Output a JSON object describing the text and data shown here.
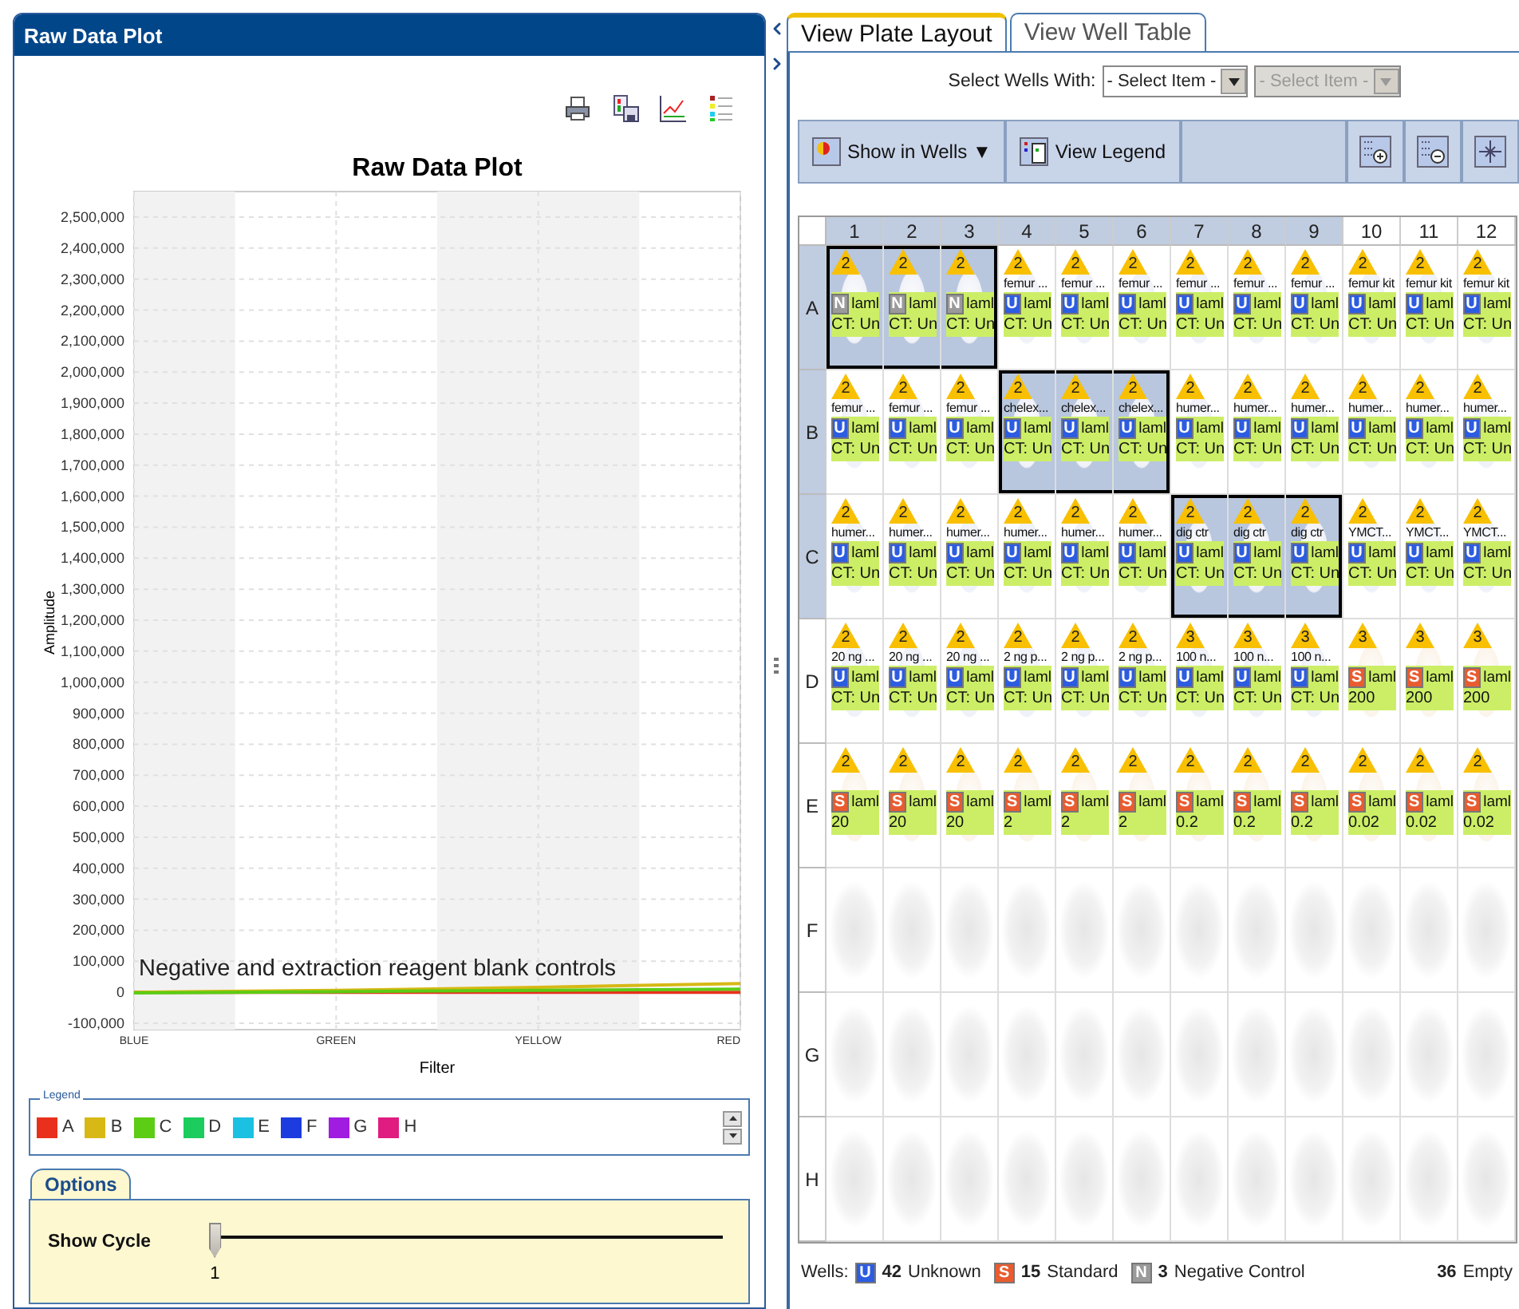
{
  "left_panel": {
    "title": "Raw Data Plot",
    "toolbar": [
      {
        "kind": "print"
      },
      {
        "kind": "save"
      },
      {
        "kind": "edit"
      },
      {
        "kind": "legend"
      }
    ],
    "chart_data": {
      "type": "line",
      "title": "Raw Data Plot",
      "xlabel": "Filter",
      "ylabel": "Amplitude",
      "categories": [
        "BLUE",
        "GREEN",
        "YELLOW",
        "RED"
      ],
      "series": [
        {
          "color": "#e8301c",
          "values": [
            0,
            0,
            0,
            0
          ]
        },
        {
          "color": "#d8b814",
          "values": [
            0,
            6000,
            16000,
            28000
          ]
        },
        {
          "color": "#5ccc14",
          "values": [
            -2000,
            2000,
            6000,
            10000
          ]
        }
      ],
      "grid": true,
      "ylim": [
        -100000,
        2500000
      ],
      "yticks": [
        {
          "value": 2500000,
          "label": "2,500,000"
        },
        {
          "value": 2400000,
          "label": "2,400,000"
        },
        {
          "value": 2300000,
          "label": "2,300,000"
        },
        {
          "value": 2200000,
          "label": "2,200,000"
        },
        {
          "value": 2100000,
          "label": "2,100,000"
        },
        {
          "value": 2000000,
          "label": "2,000,000"
        },
        {
          "value": 1900000,
          "label": "1,900,000"
        },
        {
          "value": 1800000,
          "label": "1,800,000"
        },
        {
          "value": 1700000,
          "label": "1,700,000"
        },
        {
          "value": 1600000,
          "label": "1,600,000"
        },
        {
          "value": 1500000,
          "label": "1,500,000"
        },
        {
          "value": 1400000,
          "label": "1,400,000"
        },
        {
          "value": 1300000,
          "label": "1,300,000"
        },
        {
          "value": 1200000,
          "label": "1,200,000"
        },
        {
          "value": 1100000,
          "label": "1,100,000"
        },
        {
          "value": 1000000,
          "label": "1,000,000"
        },
        {
          "value": 900000,
          "label": "900,000"
        },
        {
          "value": 800000,
          "label": "800,000"
        },
        {
          "value": 700000,
          "label": "700,000"
        },
        {
          "value": 600000,
          "label": "600,000"
        },
        {
          "value": 500000,
          "label": "500,000"
        },
        {
          "value": 400000,
          "label": "400,000"
        },
        {
          "value": 300000,
          "label": "300,000"
        },
        {
          "value": 200000,
          "label": "200,000"
        },
        {
          "value": 100000,
          "label": "100,000"
        },
        {
          "value": 0,
          "label": "0"
        },
        {
          "value": -100000,
          "label": "-100,000"
        }
      ],
      "annotations": [
        "Negative and extraction reagent blank controls"
      ]
    },
    "legend": {
      "title": "Legend",
      "items": [
        {
          "label": "A",
          "color": "#e8301c"
        },
        {
          "label": "B",
          "color": "#d8b814"
        },
        {
          "label": "C",
          "color": "#5ccc14"
        },
        {
          "label": "D",
          "color": "#1ccc5c"
        },
        {
          "label": "E",
          "color": "#1cc0e0"
        },
        {
          "label": "F",
          "color": "#1c3ce0"
        },
        {
          "label": "G",
          "color": "#a01ce0"
        },
        {
          "label": "H",
          "color": "#e01c80"
        }
      ]
    },
    "options": {
      "tab": "Options",
      "slider": {
        "label": "Show Cycle",
        "level": 0,
        "reading": "1"
      }
    }
  },
  "right_panel": {
    "tabs": [
      {
        "label": "View Plate Layout",
        "selected": true
      },
      {
        "label": "View Well Table",
        "selected": false
      }
    ],
    "select_wells": {
      "label": "Select Wells With:",
      "dropdowns": [
        {
          "value": "- Select Item -",
          "disabled": false
        },
        {
          "value": "- Select Item -",
          "disabled": true
        }
      ]
    },
    "toolbar": {
      "buttons": [
        {
          "label": "Show in Wells ▼",
          "kind": "show"
        },
        {
          "label": "View Legend",
          "kind": "legend"
        }
      ],
      "icon_buttons": [
        {
          "kind": "zoom_in"
        },
        {
          "kind": "zoom_out"
        },
        {
          "kind": "fit"
        }
      ]
    },
    "plate": {
      "columns": [
        "1",
        "2",
        "3",
        "4",
        "5",
        "6",
        "7",
        "8",
        "9",
        "10",
        "11",
        "12"
      ],
      "rows": [
        {
          "label": "A",
          "wells": [
            {
              "kind": "negative",
              "flag": "2",
              "badge": "N",
              "target": "laml",
              "ct": "CT: Un",
              "selected": true
            },
            {
              "kind": "negative",
              "flag": "2",
              "badge": "N",
              "target": "laml",
              "ct": "CT: Un",
              "selected": true
            },
            {
              "kind": "negative",
              "flag": "2",
              "badge": "N",
              "target": "laml",
              "ct": "CT: Un",
              "selected": true
            },
            {
              "kind": "unknown",
              "flag": "2",
              "name": "femur ...",
              "badge": "U",
              "target": "laml",
              "ct": "CT: Un",
              "selected": false
            },
            {
              "kind": "unknown",
              "flag": "2",
              "name": "femur ...",
              "badge": "U",
              "target": "laml",
              "ct": "CT: Un",
              "selected": false
            },
            {
              "kind": "unknown",
              "flag": "2",
              "name": "femur ...",
              "badge": "U",
              "target": "laml",
              "ct": "CT: Un",
              "selected": false
            },
            {
              "kind": "unknown",
              "flag": "2",
              "name": "femur ...",
              "badge": "U",
              "target": "laml",
              "ct": "CT: Un",
              "selected": false
            },
            {
              "kind": "unknown",
              "flag": "2",
              "name": "femur ...",
              "badge": "U",
              "target": "laml",
              "ct": "CT: Un",
              "selected": false
            },
            {
              "kind": "unknown",
              "flag": "2",
              "name": "femur ...",
              "badge": "U",
              "target": "laml",
              "ct": "CT: Un",
              "selected": false
            },
            {
              "kind": "unknown",
              "flag": "2",
              "name": "femur kit",
              "badge": "U",
              "target": "laml",
              "ct": "CT: Un",
              "selected": false
            },
            {
              "kind": "unknown",
              "flag": "2",
              "name": "femur kit",
              "badge": "U",
              "target": "laml",
              "ct": "CT: Un",
              "selected": false
            },
            {
              "kind": "unknown",
              "flag": "2",
              "name": "femur kit",
              "badge": "U",
              "target": "laml",
              "ct": "CT: Un",
              "selected": false
            }
          ]
        },
        {
          "label": "B",
          "wells": [
            {
              "kind": "unknown",
              "flag": "2",
              "name": "femur ...",
              "badge": "U",
              "target": "laml",
              "ct": "CT: Un",
              "selected": false
            },
            {
              "kind": "unknown",
              "flag": "2",
              "name": "femur ...",
              "badge": "U",
              "target": "laml",
              "ct": "CT: Un",
              "selected": false
            },
            {
              "kind": "unknown",
              "flag": "2",
              "name": "femur ...",
              "badge": "U",
              "target": "laml",
              "ct": "CT: Un",
              "selected": false
            },
            {
              "kind": "unknown",
              "flag": "2",
              "name": "chelex...",
              "badge": "U",
              "target": "laml",
              "ct": "CT: Un",
              "selected": true
            },
            {
              "kind": "unknown",
              "flag": "2",
              "name": "chelex...",
              "badge": "U",
              "target": "laml",
              "ct": "CT: Un",
              "selected": true
            },
            {
              "kind": "unknown",
              "flag": "2",
              "name": "chelex...",
              "badge": "U",
              "target": "laml",
              "ct": "CT: Un",
              "selected": true
            },
            {
              "kind": "unknown",
              "flag": "2",
              "name": "humer...",
              "badge": "U",
              "target": "laml",
              "ct": "CT: Un",
              "selected": false
            },
            {
              "kind": "unknown",
              "flag": "2",
              "name": "humer...",
              "badge": "U",
              "target": "laml",
              "ct": "CT: Un",
              "selected": false
            },
            {
              "kind": "unknown",
              "flag": "2",
              "name": "humer...",
              "badge": "U",
              "target": "laml",
              "ct": "CT: Un",
              "selected": false
            },
            {
              "kind": "unknown",
              "flag": "2",
              "name": "humer...",
              "badge": "U",
              "target": "laml",
              "ct": "CT: Un",
              "selected": false
            },
            {
              "kind": "unknown",
              "flag": "2",
              "name": "humer...",
              "badge": "U",
              "target": "laml",
              "ct": "CT: Un",
              "selected": false
            },
            {
              "kind": "unknown",
              "flag": "2",
              "name": "humer...",
              "badge": "U",
              "target": "laml",
              "ct": "CT: Un",
              "selected": false
            }
          ]
        },
        {
          "label": "C",
          "wells": [
            {
              "kind": "unknown",
              "flag": "2",
              "name": "humer...",
              "badge": "U",
              "target": "laml",
              "ct": "CT: Un",
              "selected": false
            },
            {
              "kind": "unknown",
              "flag": "2",
              "name": "humer...",
              "badge": "U",
              "target": "laml",
              "ct": "CT: Un",
              "selected": false
            },
            {
              "kind": "unknown",
              "flag": "2",
              "name": "humer...",
              "badge": "U",
              "target": "laml",
              "ct": "CT: Un",
              "selected": false
            },
            {
              "kind": "unknown",
              "flag": "2",
              "name": "humer...",
              "badge": "U",
              "target": "laml",
              "ct": "CT: Un",
              "selected": false
            },
            {
              "kind": "unknown",
              "flag": "2",
              "name": "humer...",
              "badge": "U",
              "target": "laml",
              "ct": "CT: Un",
              "selected": false
            },
            {
              "kind": "unknown",
              "flag": "2",
              "name": "humer...",
              "badge": "U",
              "target": "laml",
              "ct": "CT: Un",
              "selected": false
            },
            {
              "kind": "unknown",
              "flag": "2",
              "name": "dig ctr",
              "badge": "U",
              "target": "laml",
              "ct": "CT: Un",
              "selected": true
            },
            {
              "kind": "unknown",
              "flag": "2",
              "name": "dig ctr",
              "badge": "U",
              "target": "laml",
              "ct": "CT: Un",
              "selected": true
            },
            {
              "kind": "unknown",
              "flag": "2",
              "name": "dig ctr",
              "badge": "U",
              "target": "laml",
              "ct": "CT: Un",
              "selected": true
            },
            {
              "kind": "unknown",
              "flag": "2",
              "name": "YMCT...",
              "badge": "U",
              "target": "laml",
              "ct": "CT: Un",
              "selected": false
            },
            {
              "kind": "unknown",
              "flag": "2",
              "name": "YMCT...",
              "badge": "U",
              "target": "laml",
              "ct": "CT: Un",
              "selected": false
            },
            {
              "kind": "unknown",
              "flag": "2",
              "name": "YMCT...",
              "badge": "U",
              "target": "laml",
              "ct": "CT: Un",
              "selected": false
            }
          ]
        },
        {
          "label": "D",
          "wells": [
            {
              "kind": "unknown",
              "flag": "2",
              "name": "20 ng ...",
              "badge": "U",
              "target": "laml",
              "ct": "CT: Un",
              "selected": false
            },
            {
              "kind": "unknown",
              "flag": "2",
              "name": "20 ng ...",
              "badge": "U",
              "target": "laml",
              "ct": "CT: Un",
              "selected": false
            },
            {
              "kind": "unknown",
              "flag": "2",
              "name": "20 ng ...",
              "badge": "U",
              "target": "laml",
              "ct": "CT: Un",
              "selected": false
            },
            {
              "kind": "unknown",
              "flag": "2",
              "name": "2 ng p...",
              "badge": "U",
              "target": "laml",
              "ct": "CT: Un",
              "selected": false
            },
            {
              "kind": "unknown",
              "flag": "2",
              "name": "2 ng p...",
              "badge": "U",
              "target": "laml",
              "ct": "CT: Un",
              "selected": false
            },
            {
              "kind": "unknown",
              "flag": "2",
              "name": "2 ng p...",
              "badge": "U",
              "target": "laml",
              "ct": "CT: Un",
              "selected": false
            },
            {
              "kind": "unknown",
              "flag": "3",
              "name": "100 n...",
              "badge": "U",
              "target": "laml",
              "ct": "CT: Un",
              "selected": false
            },
            {
              "kind": "unknown",
              "flag": "3",
              "name": "100 n...",
              "badge": "U",
              "target": "laml",
              "ct": "CT: Un",
              "selected": false
            },
            {
              "kind": "unknown",
              "flag": "3",
              "name": "100 n...",
              "badge": "U",
              "target": "laml",
              "ct": "CT: Un",
              "selected": false
            },
            {
              "kind": "standard",
              "flag": "3",
              "badge": "S",
              "target": "laml",
              "quantity": "200",
              "selected": false
            },
            {
              "kind": "standard",
              "flag": "3",
              "badge": "S",
              "target": "laml",
              "quantity": "200",
              "selected": false
            },
            {
              "kind": "standard",
              "flag": "3",
              "badge": "S",
              "target": "laml",
              "quantity": "200",
              "selected": false
            }
          ]
        },
        {
          "label": "E",
          "wells": [
            {
              "kind": "standard",
              "flag": "2",
              "badge": "S",
              "target": "laml",
              "quantity": "20",
              "selected": false
            },
            {
              "kind": "standard",
              "flag": "2",
              "badge": "S",
              "target": "laml",
              "quantity": "20",
              "selected": false
            },
            {
              "kind": "standard",
              "flag": "2",
              "badge": "S",
              "target": "laml",
              "quantity": "20",
              "selected": false
            },
            {
              "kind": "standard",
              "flag": "2",
              "badge": "S",
              "target": "laml",
              "quantity": "2",
              "selected": false
            },
            {
              "kind": "standard",
              "flag": "2",
              "badge": "S",
              "target": "laml",
              "quantity": "2",
              "selected": false
            },
            {
              "kind": "standard",
              "flag": "2",
              "badge": "S",
              "target": "laml",
              "quantity": "2",
              "selected": false
            },
            {
              "kind": "standard",
              "flag": "2",
              "badge": "S",
              "target": "laml",
              "quantity": "0.2",
              "selected": false
            },
            {
              "kind": "standard",
              "flag": "2",
              "badge": "S",
              "target": "laml",
              "quantity": "0.2",
              "selected": false
            },
            {
              "kind": "standard",
              "flag": "2",
              "badge": "S",
              "target": "laml",
              "quantity": "0.2",
              "selected": false
            },
            {
              "kind": "standard",
              "flag": "2",
              "badge": "S",
              "target": "laml",
              "quantity": "0.02",
              "selected": false
            },
            {
              "kind": "standard",
              "flag": "2",
              "badge": "S",
              "target": "laml",
              "quantity": "0.02",
              "selected": false
            },
            {
              "kind": "standard",
              "flag": "2",
              "badge": "S",
              "target": "laml",
              "quantity": "0.02",
              "selected": false
            }
          ]
        },
        {
          "label": "F",
          "wells": [
            {
              "kind": "empty",
              "selected": false
            },
            {
              "kind": "empty",
              "selected": false
            },
            {
              "kind": "empty",
              "selected": false
            },
            {
              "kind": "empty",
              "selected": false
            },
            {
              "kind": "empty",
              "selected": false
            },
            {
              "kind": "empty",
              "selected": false
            },
            {
              "kind": "empty",
              "selected": false
            },
            {
              "kind": "empty",
              "selected": false
            },
            {
              "kind": "empty",
              "selected": false
            },
            {
              "kind": "empty",
              "selected": false
            },
            {
              "kind": "empty",
              "selected": false
            },
            {
              "kind": "empty",
              "selected": false
            }
          ]
        },
        {
          "label": "G",
          "wells": [
            {
              "kind": "empty",
              "selected": false
            },
            {
              "kind": "empty",
              "selected": false
            },
            {
              "kind": "empty",
              "selected": false
            },
            {
              "kind": "empty",
              "selected": false
            },
            {
              "kind": "empty",
              "selected": false
            },
            {
              "kind": "empty",
              "selected": false
            },
            {
              "kind": "empty",
              "selected": false
            },
            {
              "kind": "empty",
              "selected": false
            },
            {
              "kind": "empty",
              "selected": false
            },
            {
              "kind": "empty",
              "selected": false
            },
            {
              "kind": "empty",
              "selected": false
            },
            {
              "kind": "empty",
              "selected": false
            }
          ]
        },
        {
          "label": "H",
          "wells": [
            {
              "kind": "empty",
              "selected": false
            },
            {
              "kind": "empty",
              "selected": false
            },
            {
              "kind": "empty",
              "selected": false
            },
            {
              "kind": "empty",
              "selected": false
            },
            {
              "kind": "empty",
              "selected": false
            },
            {
              "kind": "empty",
              "selected": false
            },
            {
              "kind": "empty",
              "selected": false
            },
            {
              "kind": "empty",
              "selected": false
            },
            {
              "kind": "empty",
              "selected": false
            },
            {
              "kind": "empty",
              "selected": false
            },
            {
              "kind": "empty",
              "selected": false
            },
            {
              "kind": "empty",
              "selected": false
            }
          ]
        }
      ]
    },
    "status_bar": {
      "label": "Wells:",
      "counts": [
        {
          "kind": "unknown",
          "badge": "U",
          "count": "42",
          "label": "Unknown"
        },
        {
          "kind": "standard",
          "badge": "S",
          "count": "15",
          "label": "Standard"
        },
        {
          "kind": "negative",
          "badge": "N",
          "count": "3",
          "label": "Negative Control"
        },
        {
          "kind": "empty",
          "count": "36",
          "label": "Empty"
        }
      ]
    }
  }
}
